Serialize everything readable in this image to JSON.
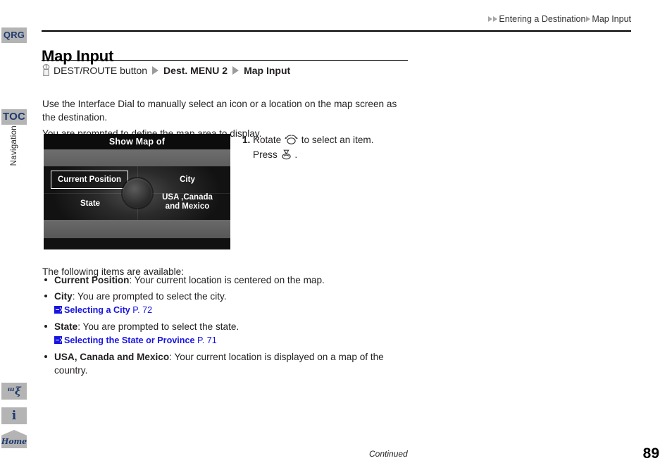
{
  "sidebar": {
    "tabs": [
      {
        "id": "qrg",
        "label": "QRG"
      },
      {
        "id": "toc",
        "label": "TOC"
      }
    ],
    "section_label": "Navigation",
    "icon_tabs": [
      {
        "id": "pen",
        "icon": "handwriting-icon",
        "glyph": "ᵚξ"
      },
      {
        "id": "info",
        "icon": "info-icon",
        "glyph": "i"
      },
      {
        "id": "home",
        "icon": "home-icon",
        "label": "Home"
      }
    ]
  },
  "header": {
    "breadcrumb_1": "Entering a Destination",
    "breadcrumb_2": "Map Input"
  },
  "title": "Map Input",
  "nav_path": {
    "button_label": "DEST/ROUTE button",
    "step_1": "Dest. MENU 2",
    "step_2": "Map Input"
  },
  "body": {
    "para1": "Use the Interface Dial to manually select an icon or a location on the map screen as the destination.",
    "para2": "You are prompted to define the map area to display.",
    "para3": "The following items are available:"
  },
  "nav_screen": {
    "title_bar": "Show Map of",
    "cells": {
      "current_position": "Current Position",
      "city": "City",
      "state": "State",
      "usa_canada_mexico": "USA ,Canada\nand Mexico"
    },
    "usa_line1": "USA ,Canada",
    "usa_line2": "and Mexico"
  },
  "step": {
    "number": "1.",
    "text_before_icon": "Rotate",
    "text_after_icon": "to select an item.",
    "press_label": "Press",
    "press_suffix": "."
  },
  "bullets": [
    {
      "term": "Current Position",
      "desc": ": Your current location is centered on the map.",
      "xref": null
    },
    {
      "term": "City",
      "desc": ": You are prompted to select the city.",
      "xref": {
        "title": "Selecting a City",
        "page": "P. 72"
      }
    },
    {
      "term": "State",
      "desc": ": You are prompted to select the state.",
      "xref": {
        "title": "Selecting the State or Province",
        "page": "P. 71"
      }
    },
    {
      "term": "USA, Canada and Mexico",
      "desc": ": Your current location is displayed on a map of the country.",
      "xref": null
    }
  ],
  "footer": {
    "continued": "Continued",
    "page_number": "89"
  },
  "colors": {
    "tab_bg": "#b4b4b4",
    "tab_text": "#1f3b6e",
    "link_blue": "#1814e0",
    "rule": "#000000",
    "header_triangle": "#a6a6a6"
  }
}
